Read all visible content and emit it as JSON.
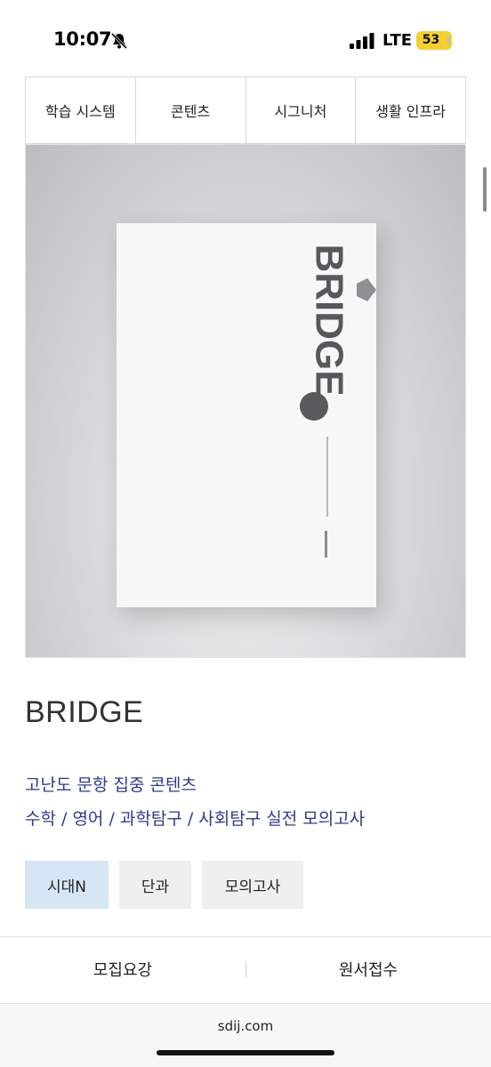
{
  "status": {
    "time": "10:07",
    "network": "LTE",
    "battery": "53",
    "battery_color": "#f4cf30"
  },
  "tabs": [
    {
      "label": "학습 시스템",
      "active": false
    },
    {
      "label": "콘텐츠",
      "active": true
    },
    {
      "label": "시그니처",
      "active": false
    },
    {
      "label": "생활 인프라",
      "active": false
    }
  ],
  "hero": {
    "book_title": "BRIDGE",
    "icons": [
      "bell-slash-icon",
      "signal-icon",
      "battery-icon"
    ]
  },
  "product": {
    "title": "BRIDGE",
    "desc_line1": "고난도 문항 집중 콘텐츠",
    "desc_line2": "수학 / 영어 / 과학탐구 / 사회탐구 실전 모의고사",
    "desc_color": "#2f3a8c"
  },
  "chips": [
    {
      "label": "시대N",
      "active": true
    },
    {
      "label": "단과",
      "active": false
    },
    {
      "label": "모의고사",
      "active": false
    }
  ],
  "bottom": {
    "left_label": "모집요강",
    "right_label": "원서접수"
  },
  "browser": {
    "url": "sdij.com"
  }
}
